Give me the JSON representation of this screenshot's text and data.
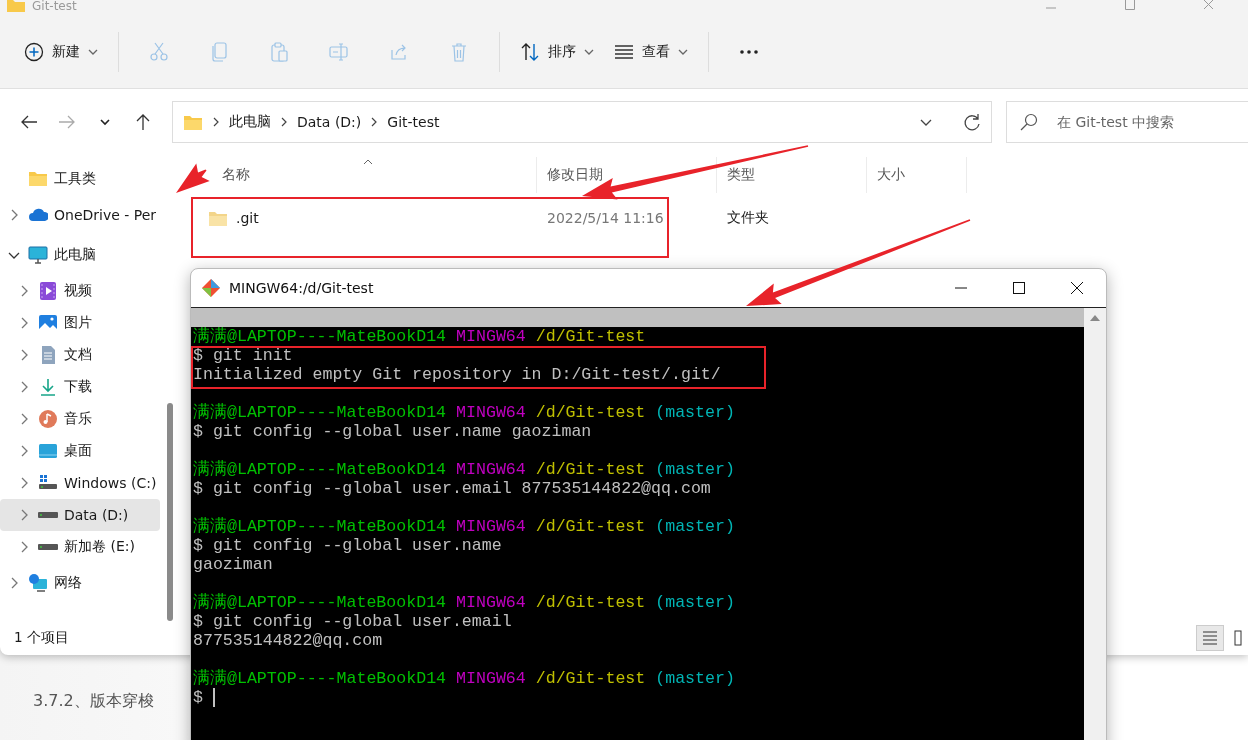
{
  "document": {
    "headings": [
      "3.7.2、版本穿梭"
    ]
  },
  "explorer": {
    "title": "Git-test",
    "toolbar": [
      {
        "kind": "new",
        "label": "新建",
        "disabled": false
      },
      {
        "kind": "cut",
        "disabled": true
      },
      {
        "kind": "copy",
        "disabled": true
      },
      {
        "kind": "paste",
        "disabled": true
      },
      {
        "kind": "rename",
        "disabled": true
      },
      {
        "kind": "share",
        "disabled": true
      },
      {
        "kind": "delete",
        "disabled": true
      },
      {
        "kind": "sort",
        "label": "排序",
        "disabled": false
      },
      {
        "kind": "view",
        "label": "查看",
        "disabled": false
      },
      {
        "kind": "more",
        "disabled": false
      }
    ],
    "address": {
      "crumbs": [
        "此电脑",
        "Data (D:)",
        "Git-test"
      ]
    },
    "search": {
      "placeholder": "在 Git-test 中搜索"
    },
    "sidebar": {
      "items": [
        {
          "label": "工具类",
          "kind": "folder",
          "selected": false
        },
        {
          "label": "OneDrive - Per",
          "kind": "cloud",
          "expanded": false,
          "selected": false
        },
        {
          "label": "此电脑",
          "kind": "pc",
          "expanded": true,
          "selected": false,
          "children": [
            {
              "label": "视频",
              "kind": "video",
              "expanded": false,
              "selected": false
            },
            {
              "label": "图片",
              "kind": "image",
              "expanded": false,
              "selected": false
            },
            {
              "label": "文档",
              "kind": "doc",
              "expanded": false,
              "selected": false
            },
            {
              "label": "下载",
              "kind": "download",
              "expanded": false,
              "selected": false
            },
            {
              "label": "音乐",
              "kind": "music",
              "expanded": false,
              "selected": false
            },
            {
              "label": "桌面",
              "kind": "desktop",
              "expanded": false,
              "selected": false
            },
            {
              "label": "Windows (C:)",
              "kind": "windrive",
              "expanded": false,
              "selected": false
            },
            {
              "label": "Data (D:)",
              "kind": "drive",
              "expanded": false,
              "selected": true
            },
            {
              "label": "新加卷 (E:)",
              "kind": "drive",
              "expanded": false,
              "selected": false
            }
          ]
        },
        {
          "label": "网络",
          "kind": "network",
          "expanded": false,
          "selected": false
        }
      ]
    },
    "columns": [
      {
        "label": "名称",
        "sorted": true
      },
      {
        "label": "修改日期",
        "sorted": false
      },
      {
        "label": "类型",
        "sorted": false
      },
      {
        "label": "大小",
        "sorted": false
      }
    ],
    "rows": [
      {
        "name": ".git",
        "modified": "2022/5/14 11:16",
        "type": "文件夹"
      }
    ],
    "status": "1 个项目",
    "view_modes": [
      {
        "kind": "details",
        "selected": true
      },
      {
        "kind": "tiles",
        "selected": false
      }
    ]
  },
  "terminal": {
    "title": "MINGW64:/d/Git-test",
    "lines": [
      {
        "kind": "prompt",
        "user": "满满@LAPTOP----MateBookD14",
        "system": "MINGW64",
        "path": "/d/Git-test"
      },
      {
        "kind": "command",
        "text": "$ git init"
      },
      {
        "kind": "output",
        "text": "Initialized empty Git repository in D:/Git-test/.git/"
      },
      {
        "kind": "blank"
      },
      {
        "kind": "prompt",
        "user": "满满@LAPTOP----MateBookD14",
        "system": "MINGW64",
        "path": "/d/Git-test",
        "branch": "(master)"
      },
      {
        "kind": "command",
        "text": "$ git config --global user.name gaoziman"
      },
      {
        "kind": "blank"
      },
      {
        "kind": "prompt",
        "user": "满满@LAPTOP----MateBookD14",
        "system": "MINGW64",
        "path": "/d/Git-test",
        "branch": "(master)"
      },
      {
        "kind": "command",
        "text": "$ git config --global user.email 877535144822@qq.com"
      },
      {
        "kind": "blank"
      },
      {
        "kind": "prompt",
        "user": "满满@LAPTOP----MateBookD14",
        "system": "MINGW64",
        "path": "/d/Git-test",
        "branch": "(master)"
      },
      {
        "kind": "command",
        "text": "$ git config --global user.name"
      },
      {
        "kind": "output",
        "text": "gaoziman"
      },
      {
        "kind": "blank"
      },
      {
        "kind": "prompt",
        "user": "满满@LAPTOP----MateBookD14",
        "system": "MINGW64",
        "path": "/d/Git-test",
        "branch": "(master)"
      },
      {
        "kind": "command",
        "text": "$ git config --global user.email"
      },
      {
        "kind": "output",
        "text": "877535144822@qq.com"
      },
      {
        "kind": "blank"
      },
      {
        "kind": "prompt",
        "user": "满满@LAPTOP----MateBookD14",
        "system": "MINGW64",
        "path": "/d/Git-test",
        "branch": "(master)"
      },
      {
        "kind": "command",
        "text": "$",
        "cursor": true
      }
    ]
  },
  "annotations": [
    {
      "kind": "arrow"
    },
    {
      "kind": "arrow"
    },
    {
      "kind": "arrow"
    },
    {
      "kind": "box"
    },
    {
      "kind": "box"
    }
  ]
}
